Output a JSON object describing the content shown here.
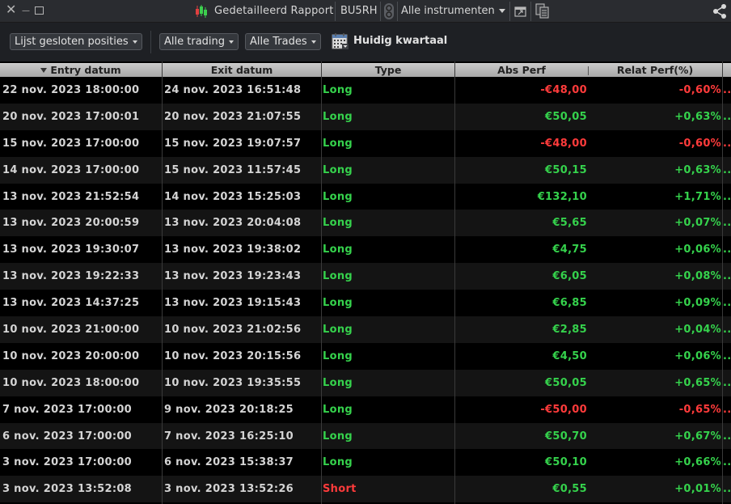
{
  "titlebar": {
    "title": "Gedetailleerd Rapport",
    "account": "BU5RH",
    "instrument_filter": "Alle instrumenten",
    "close_glyph": "✕",
    "minimize_glyph": "—",
    "icons": [
      "close-icon",
      "minimize-icon",
      "maximize-icon",
      "candlestick-icon",
      "link-icon",
      "popout-icon",
      "copy-icon",
      "share-icon"
    ]
  },
  "toolbar": {
    "positions_filter": "Lijst gesloten posities",
    "trading_filter": "Alle trading",
    "trades_filter": "Alle Trades",
    "period": "Huidig kwartaal"
  },
  "table": {
    "columns": [
      "Entry datum",
      "Exit datum",
      "Type",
      "Abs Perf",
      "Relat Perf(%)"
    ],
    "sorted_column": "Entry datum",
    "more_glyph": "..",
    "rows": [
      {
        "entry": "22 nov. 2023 18:00:00",
        "exit": "24 nov. 2023 16:51:48",
        "type": "Long",
        "abs": "-€48,00",
        "rel": "-0,60%",
        "sign": "neg"
      },
      {
        "entry": "20 nov. 2023 17:00:01",
        "exit": "20 nov. 2023 21:07:55",
        "type": "Long",
        "abs": "€50,05",
        "rel": "+0,63%",
        "sign": "pos"
      },
      {
        "entry": "15 nov. 2023 17:00:00",
        "exit": "15 nov. 2023 19:07:57",
        "type": "Long",
        "abs": "-€48,00",
        "rel": "-0,60%",
        "sign": "neg"
      },
      {
        "entry": "14 nov. 2023 17:00:00",
        "exit": "15 nov. 2023 11:57:45",
        "type": "Long",
        "abs": "€50,15",
        "rel": "+0,63%",
        "sign": "pos"
      },
      {
        "entry": "13 nov. 2023 21:52:54",
        "exit": "14 nov. 2023 15:25:03",
        "type": "Long",
        "abs": "€132,10",
        "rel": "+1,71%",
        "sign": "pos"
      },
      {
        "entry": "13 nov. 2023 20:00:59",
        "exit": "13 nov. 2023 20:04:08",
        "type": "Long",
        "abs": "€5,65",
        "rel": "+0,07%",
        "sign": "pos"
      },
      {
        "entry": "13 nov. 2023 19:30:07",
        "exit": "13 nov. 2023 19:38:02",
        "type": "Long",
        "abs": "€4,75",
        "rel": "+0,06%",
        "sign": "pos"
      },
      {
        "entry": "13 nov. 2023 19:22:33",
        "exit": "13 nov. 2023 19:23:43",
        "type": "Long",
        "abs": "€6,05",
        "rel": "+0,08%",
        "sign": "pos"
      },
      {
        "entry": "13 nov. 2023 14:37:25",
        "exit": "13 nov. 2023 19:15:43",
        "type": "Long",
        "abs": "€6,85",
        "rel": "+0,09%",
        "sign": "pos"
      },
      {
        "entry": "10 nov. 2023 21:00:00",
        "exit": "10 nov. 2023 21:02:56",
        "type": "Long",
        "abs": "€2,85",
        "rel": "+0,04%",
        "sign": "pos"
      },
      {
        "entry": "10 nov. 2023 20:00:00",
        "exit": "10 nov. 2023 20:15:56",
        "type": "Long",
        "abs": "€4,50",
        "rel": "+0,06%",
        "sign": "pos"
      },
      {
        "entry": "10 nov. 2023 18:00:00",
        "exit": "10 nov. 2023 19:35:55",
        "type": "Long",
        "abs": "€50,05",
        "rel": "+0,65%",
        "sign": "pos"
      },
      {
        "entry": "7 nov. 2023 17:00:00",
        "exit": "9 nov. 2023 20:18:25",
        "type": "Long",
        "abs": "-€50,00",
        "rel": "-0,65%",
        "sign": "neg"
      },
      {
        "entry": "6 nov. 2023 17:00:00",
        "exit": "7 nov. 2023 16:25:10",
        "type": "Long",
        "abs": "€50,70",
        "rel": "+0,67%",
        "sign": "pos"
      },
      {
        "entry": "3 nov. 2023 17:00:00",
        "exit": "6 nov. 2023 15:38:37",
        "type": "Long",
        "abs": "€50,10",
        "rel": "+0,66%",
        "sign": "pos"
      },
      {
        "entry": "3 nov. 2023 13:52:08",
        "exit": "3 nov. 2023 13:52:26",
        "type": "Short",
        "abs": "€0,55",
        "rel": "+0,01%",
        "sign": "pos"
      }
    ]
  },
  "colors": {
    "positive": "#35d24c",
    "negative": "#ff3b3b",
    "long": "#35d24c",
    "short": "#ff3b3b",
    "header_bg": "#b8b8b8",
    "title_bg": "#2a2c30"
  }
}
